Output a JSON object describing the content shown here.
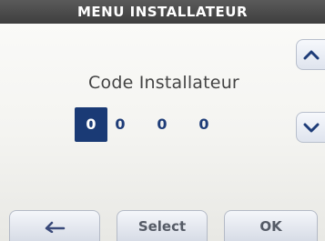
{
  "header": {
    "title": "MENU INSTALLATEUR"
  },
  "main": {
    "label": "Code Installateur",
    "digits": [
      "0",
      "0",
      "0",
      "0"
    ],
    "active_digit": 1
  },
  "side_controls": {
    "up_icon": "chevron-up-icon",
    "down_icon": "chevron-down-icon"
  },
  "footer": {
    "back_icon": "back-arrow-icon",
    "select_label": "Select",
    "ok_label": "OK"
  },
  "colors": {
    "title_bar": "#464646",
    "active_digit_bg": "#1a3a75",
    "digit_text": "#1e3c78",
    "button_text": "#555b66"
  }
}
